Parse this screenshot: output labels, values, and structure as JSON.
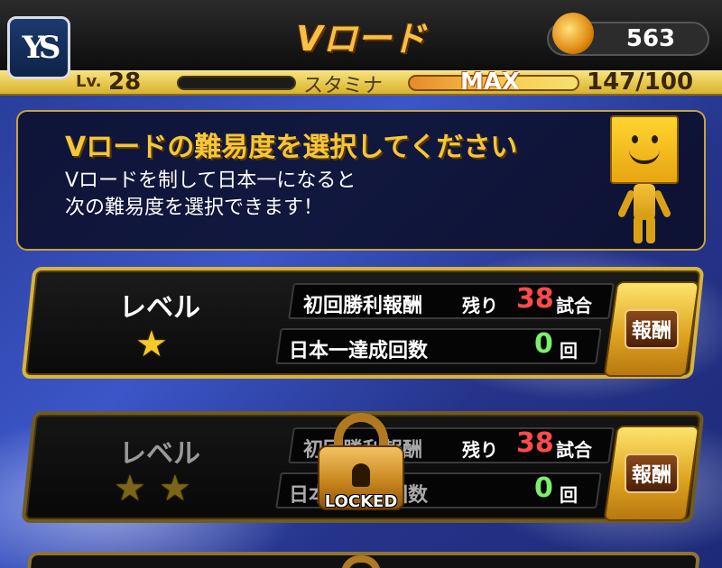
{
  "header": {
    "title": "Vロード",
    "team_logo_text": "YS",
    "coins": "563"
  },
  "status": {
    "lv_label": "Lv.",
    "lv_value": "28",
    "stamina_label": "スタミナ",
    "stamina_max": "MAX",
    "stamina_value": "147/100"
  },
  "info": {
    "title": "Vロードの難易度を選択してください",
    "body": "Vロードを制して日本一になると\n次の難易度を選択できます！"
  },
  "levels": [
    {
      "label": "レベル",
      "stars": 1,
      "first_win_label": "初回勝利報酬",
      "remaining_word": "残り",
      "remaining_value": "38",
      "remaining_unit": "試合",
      "champion_label": "日本一達成回数",
      "champion_value": "0",
      "champion_unit": "回",
      "reward_label": "報酬",
      "locked": false
    },
    {
      "label": "レベル",
      "stars": 2,
      "first_win_label": "初回勝利報酬",
      "remaining_word": "残り",
      "remaining_value": "38",
      "remaining_unit": "試合",
      "champion_label": "日本一達成回数",
      "champion_value": "0",
      "champion_unit": "回",
      "reward_label": "報酬",
      "locked": true,
      "lock_text": "LOCKED"
    }
  ],
  "colors": {
    "gold": "#f5c63a",
    "remaining_red": "#ff4a4a",
    "count_green": "#7bf06a"
  }
}
